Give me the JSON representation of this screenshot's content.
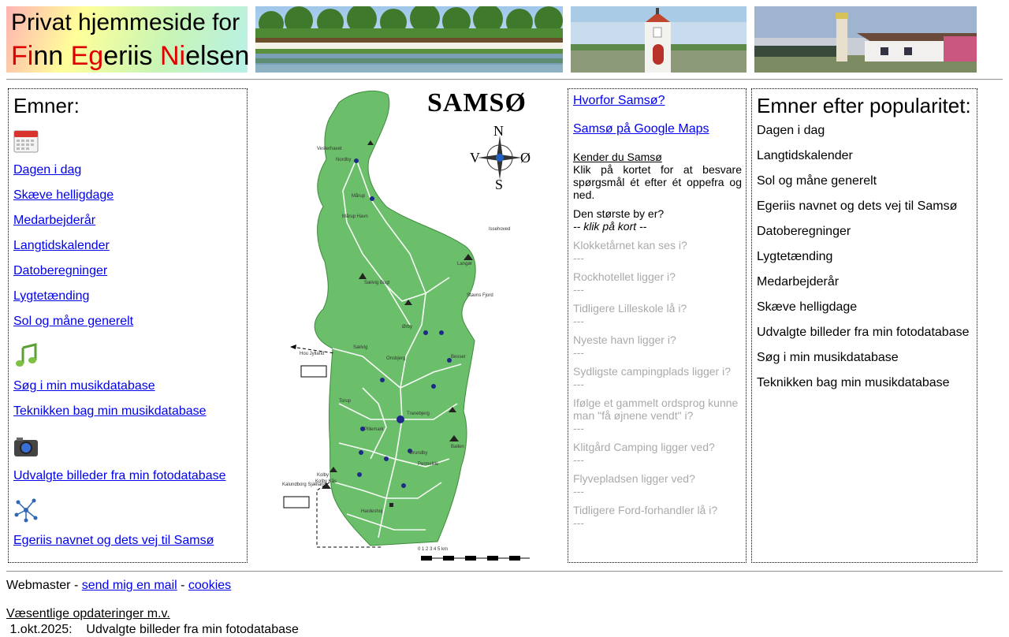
{
  "header": {
    "title_line1": "Privat hjemmeside for",
    "name_parts": [
      {
        "text": "Fi",
        "red": true
      },
      {
        "text": "nn ",
        "red": false
      },
      {
        "text": "Eg",
        "red": true
      },
      {
        "text": "eriis ",
        "red": false
      },
      {
        "text": "Ni",
        "red": true
      },
      {
        "text": "elsen",
        "red": false
      }
    ]
  },
  "topics": {
    "heading": "Emner:",
    "links": [
      {
        "label": "Dagen i dag"
      },
      {
        "label": "Skæve helligdage"
      },
      {
        "label": "Medarbejderår"
      },
      {
        "label": "Langtidskalender"
      },
      {
        "label": "Datoberegninger"
      },
      {
        "label": "Lygtetænding"
      },
      {
        "label": "Sol og måne generelt"
      },
      {
        "label": "Søg i min musikdatabase"
      },
      {
        "label": "Teknikken bag min musikdatabase"
      },
      {
        "label": "Udvalgte billeder fra min fotodatabase"
      },
      {
        "label": "Egeriis navnet og dets vej til Samsø"
      }
    ],
    "icons": [
      "calendar-icon",
      "music-note-icon",
      "camera-icon",
      "family-tree-icon"
    ]
  },
  "map": {
    "title": "SAMSØ",
    "compass": {
      "n": "N",
      "s": "S",
      "v": "V",
      "o": "Ø"
    },
    "places": [
      "Nordby",
      "Mårup",
      "Mårup Havn",
      "Langør",
      "Onsbjerg",
      "Brundby",
      "Tranebjerg",
      "Ballen",
      "Kolby",
      "Kolby Kås",
      "Sælvig",
      "Besser",
      "Pillemark",
      "Issehoved",
      "Stavns Fjord",
      "Hou Jylland",
      "Kalundborg Sjælland",
      "Ørby",
      "Permelille",
      "Hardeshoj",
      "Torup",
      "Sælvig Bugt",
      "Vesterhavet"
    ],
    "scale": "0 1 2 3 4 5 km"
  },
  "quiz": {
    "why_link": "Hvorfor Samsø?",
    "maps_link": "Samsø på Google Maps",
    "know_heading": "Kender du Samsø",
    "instructions": "Klik på kortet for at besvare spørgsmål ét efter ét oppefra og ned.",
    "active_question": "Den største by er?",
    "active_hint": "-- klik på kort --",
    "questions": [
      {
        "q": "Klokketårnet kan ses i?",
        "a": "---"
      },
      {
        "q": "Rockhotellet ligger i?",
        "a": "---"
      },
      {
        "q": "Tidligere Lilleskole lå i?",
        "a": "---"
      },
      {
        "q": "Nyeste havn ligger i?",
        "a": "---"
      },
      {
        "q": "Sydligste campingplads ligger i?",
        "a": "---"
      },
      {
        "q": "Ifølge et gammelt ordsprog kunne man \"få øjnene vendt\" i?",
        "a": "---"
      },
      {
        "q": "Klitgård Camping ligger ved?",
        "a": "---"
      },
      {
        "q": "Flyvepladsen ligger ved?",
        "a": "---"
      },
      {
        "q": "Tidligere Ford-forhandler lå i?",
        "a": "---"
      }
    ]
  },
  "popular": {
    "heading": "Emner efter popularitet:",
    "items": [
      "Dagen i dag",
      "Langtidskalender",
      "Sol og måne generelt",
      "Egeriis navnet og dets vej til Samsø",
      "Datoberegninger",
      "Lygtetænding",
      "Medarbejderår",
      "Skæve helligdage",
      "Udvalgte billeder fra min fotodatabase",
      "Søg i min musikdatabase",
      "Teknikken bag min musikdatabase"
    ]
  },
  "footer": {
    "webmaster": "Webmaster - ",
    "mail_link": "send mig en mail",
    "sep": " - ",
    "cookies_link": "cookies",
    "updates_heading": "Væsentlige opdateringer m.v.",
    "update_line": " 1.okt.2025:    Udvalgte billeder fra min fotodatabase"
  },
  "colors": {
    "link": "#0000ee",
    "red": "#e00000",
    "map_green": "#6cbf6a",
    "grey": "#aaaaaa"
  }
}
